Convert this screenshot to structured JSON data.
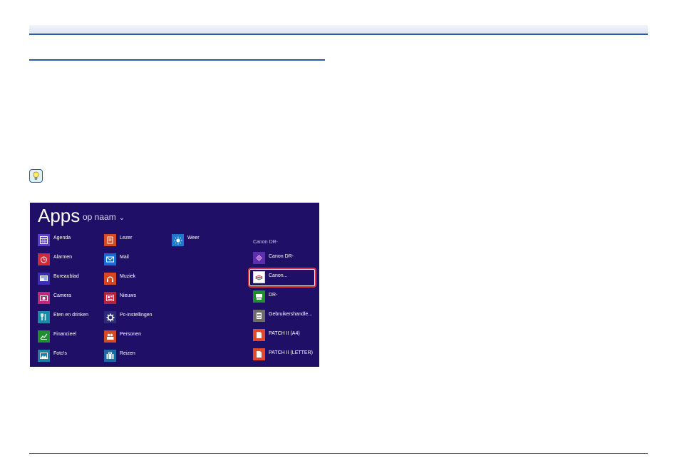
{
  "apps_screen": {
    "title": "Apps",
    "sort_label": "op naam",
    "group_header": "Canon DR-",
    "columns": [
      [
        {
          "label": "Agenda",
          "icon": "calendar-icon",
          "color": "#5b3fc4"
        },
        {
          "label": "Alarmen",
          "icon": "alarm-clock-icon",
          "color": "#d0293a"
        },
        {
          "label": "Bureaublad",
          "icon": "desktop-icon",
          "color": "#3b2fb8"
        },
        {
          "label": "Camera",
          "icon": "camera-icon",
          "color": "#c3247c"
        },
        {
          "label": "Eten en drinken",
          "icon": "food-icon",
          "color": "#1b8aa6"
        },
        {
          "label": "Financieel",
          "icon": "finance-chart-icon",
          "color": "#1d8f2e"
        },
        {
          "label": "Foto's",
          "icon": "photos-icon",
          "color": "#1c7ea6"
        }
      ],
      [
        {
          "label": "Lezer",
          "icon": "reader-icon",
          "color": "#d64b24"
        },
        {
          "label": "Mail",
          "icon": "mail-icon",
          "color": "#1a6dd0"
        },
        {
          "label": "Muziek",
          "icon": "headphones-icon",
          "color": "#d9461f"
        },
        {
          "label": "Nieuws",
          "icon": "news-icon",
          "color": "#b3243b"
        },
        {
          "label": "Pc-instellingen",
          "icon": "gear-icon",
          "color": "#2e2a7a"
        },
        {
          "label": "Personen",
          "icon": "people-icon",
          "color": "#d64b24"
        },
        {
          "label": "Reizen",
          "icon": "suitcase-icon",
          "color": "#1b6aa6"
        }
      ],
      [
        {
          "label": "Weer",
          "icon": "weather-sun-icon",
          "color": "#1a7ad0"
        }
      ],
      [
        {
          "label": "Canon DR-",
          "icon": "scanner-app-icon",
          "color": "#5b2fb0"
        },
        {
          "label": "Canon...",
          "icon": "capture-app-icon",
          "color": "#ffffff"
        },
        {
          "label": "DR-",
          "icon": "driver-app-icon",
          "color": "#1d8f2e"
        },
        {
          "label": "Gebruikershandle...",
          "icon": "document-icon",
          "color": "#6b6b6b"
        },
        {
          "label": "PATCH II (A4)",
          "icon": "file-icon",
          "color": "#e04a2a"
        },
        {
          "label": "PATCH II (LETTER)",
          "icon": "file-icon",
          "color": "#e04a2a"
        }
      ]
    ]
  }
}
